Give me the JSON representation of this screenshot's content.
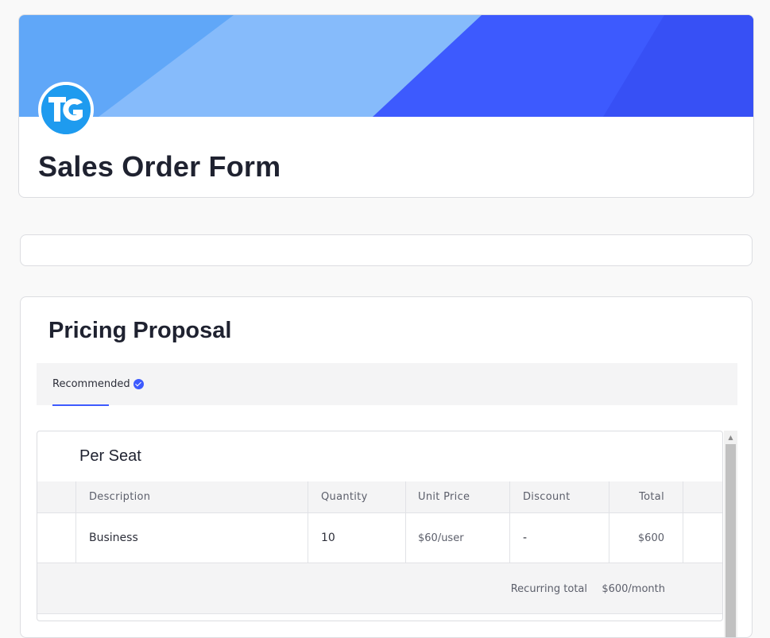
{
  "header": {
    "title": "Sales Order Form",
    "logo_icon": "tg-logo-icon",
    "banner_colors": [
      "#60a7f8",
      "#86bbfb",
      "#3d5afe"
    ]
  },
  "pricing": {
    "title": "Pricing Proposal",
    "tabs": [
      {
        "label": "Recommended",
        "icon": "check-badge-icon",
        "active": true
      }
    ],
    "plan": {
      "title": "Per Seat",
      "columns": [
        "Description",
        "Quantity",
        "Unit Price",
        "Discount",
        "Total"
      ],
      "rows": [
        {
          "description": "Business",
          "quantity": "10",
          "unit_price": "$60/user",
          "discount": "-",
          "total": "$600"
        }
      ],
      "recurring_label": "Recurring total",
      "recurring_value": "$600/month"
    }
  },
  "colors": {
    "accent": "#3d5afe"
  }
}
